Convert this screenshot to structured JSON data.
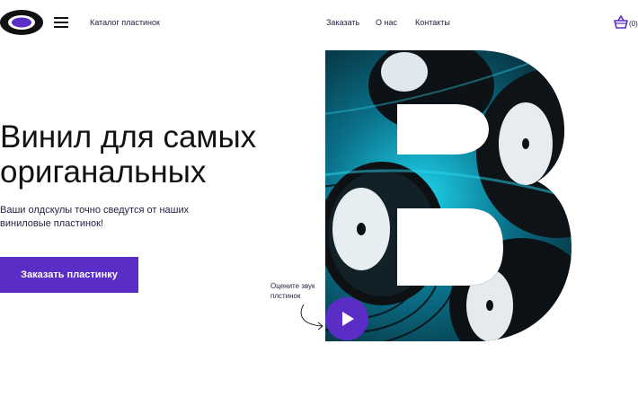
{
  "header": {
    "catalog_label": "Каталог пластинок",
    "nav": [
      {
        "label": "Заказать"
      },
      {
        "label": "О нас"
      },
      {
        "label": "Контакты"
      }
    ],
    "cart_count": "(0)",
    "logo_icon": "vinyl-logo-icon",
    "menu_icon": "hamburger-icon",
    "cart_icon": "basket-icon"
  },
  "hero": {
    "title_line1": "Винил для самых",
    "title_line2": "ориганальных",
    "subtitle_line1": "Ваши олдскулы точно сведутся от наших",
    "subtitle_line2": "виниловые пластинок!",
    "cta_label": "Заказать пластинку"
  },
  "sound": {
    "label_line1": "Оцените звук",
    "label_line2": "плстинок",
    "play_icon": "play-icon"
  },
  "colors": {
    "accent": "#5a2dc7",
    "text_dark": "#1f2040",
    "vinyl_cyan": "#19c3e0"
  }
}
